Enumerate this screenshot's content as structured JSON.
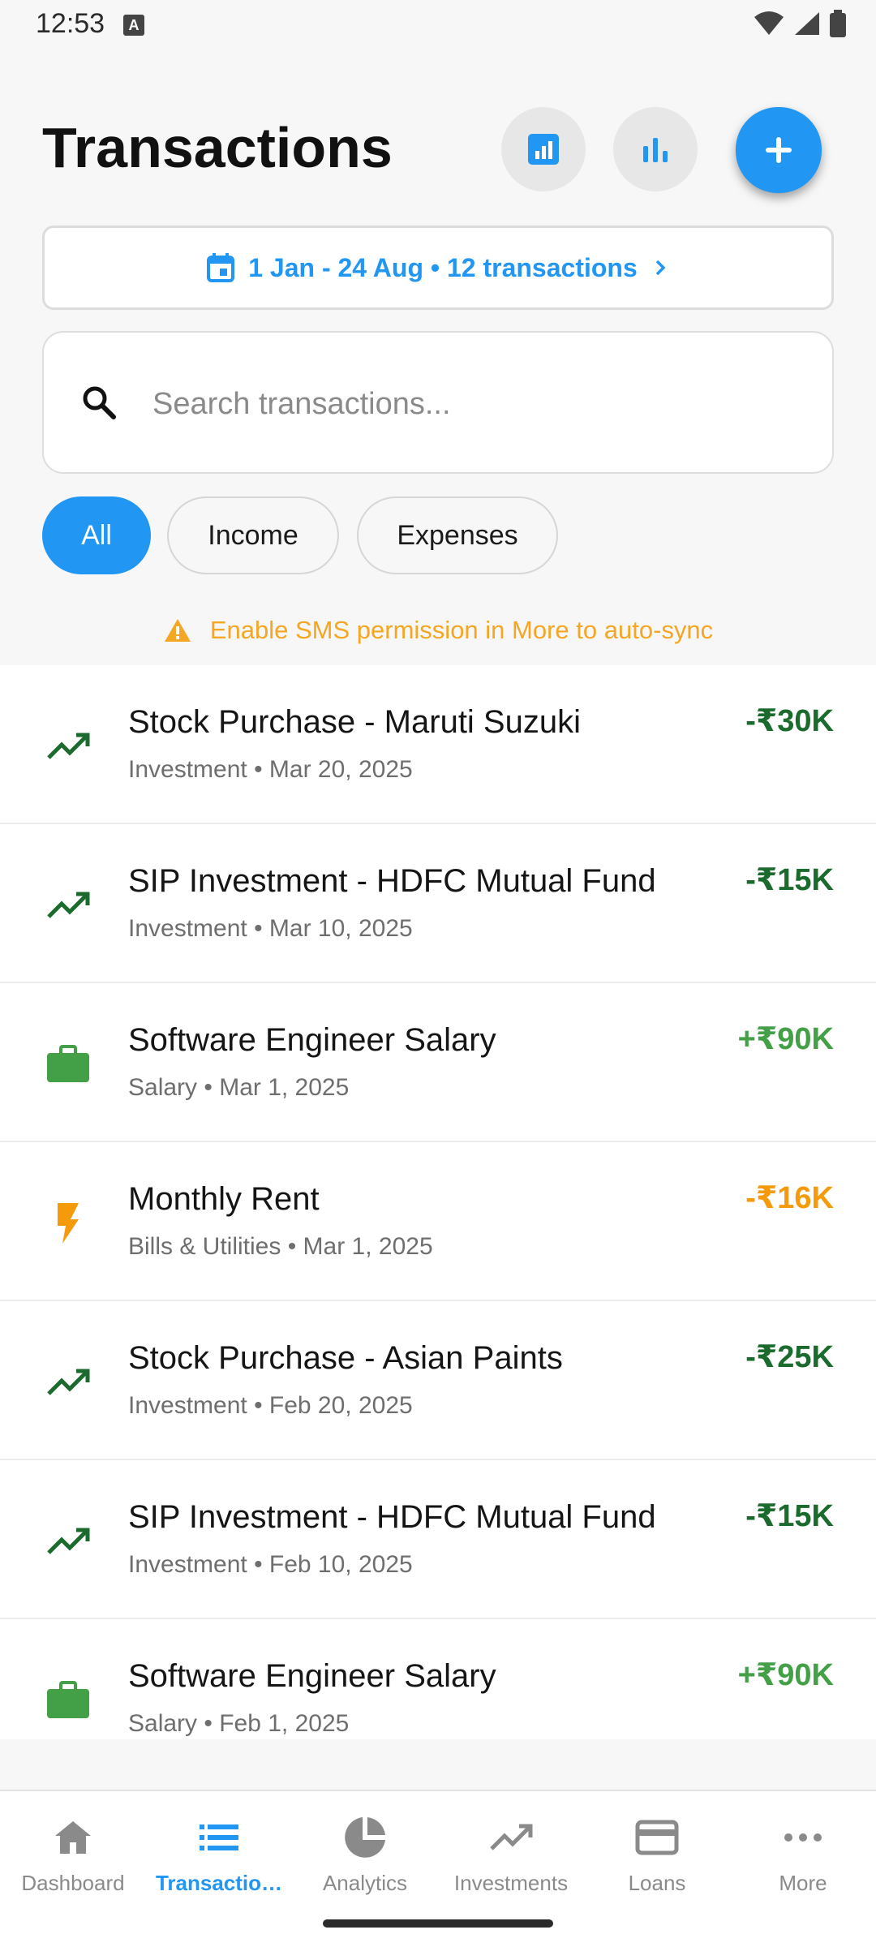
{
  "status_bar": {
    "time": "12:53",
    "notification_icon": "A"
  },
  "header": {
    "title": "Transactions",
    "buttons": [
      {
        "icon": "report-chart-icon",
        "label": ""
      },
      {
        "icon": "bar-chart-icon",
        "label": ""
      },
      {
        "icon": "add-icon",
        "label": ""
      }
    ]
  },
  "date_filter": {
    "label": "1 Jan - 24 Aug • 12 transactions"
  },
  "search": {
    "placeholder": "Search transactions...",
    "value": ""
  },
  "filters": {
    "all": "All",
    "income": "Income",
    "expenses": "Expenses",
    "selected": "All"
  },
  "sms_banner": {
    "text": "Enable SMS permission in More to auto-sync"
  },
  "colors": {
    "accent": "#2196f3",
    "investment_icon": "#1b6b2e",
    "investment_amount": "#1b6b2e",
    "salary": "#43a047",
    "bills": "#f59a0b",
    "warning": "#f5a623"
  },
  "transactions": [
    {
      "title": "Stock Purchase - Maruti Suzuki",
      "subtitle": "Investment • Mar 20, 2025",
      "amount": "-₹30K",
      "icon": "trending-up-icon",
      "type": "investment"
    },
    {
      "title": "SIP Investment - HDFC Mutual Fund",
      "subtitle": "Investment • Mar 10, 2025",
      "amount": "-₹15K",
      "icon": "trending-up-icon",
      "type": "investment"
    },
    {
      "title": "Software Engineer Salary",
      "subtitle": "Salary • Mar 1, 2025",
      "amount": "+₹90K",
      "icon": "briefcase-icon",
      "type": "salary"
    },
    {
      "title": "Monthly Rent",
      "subtitle": "Bills & Utilities • Mar 1, 2025",
      "amount": "-₹16K",
      "icon": "bolt-icon",
      "type": "bills"
    },
    {
      "title": "Stock Purchase - Asian Paints",
      "subtitle": "Investment • Feb 20, 2025",
      "amount": "-₹25K",
      "icon": "trending-up-icon",
      "type": "investment"
    },
    {
      "title": "SIP Investment - HDFC Mutual Fund",
      "subtitle": "Investment • Feb 10, 2025",
      "amount": "-₹15K",
      "icon": "trending-up-icon",
      "type": "investment"
    },
    {
      "title": "Software Engineer Salary",
      "subtitle": "Salary • Feb 1, 2025",
      "amount": "+₹90K",
      "icon": "briefcase-icon",
      "type": "salary"
    }
  ],
  "bottom_nav": {
    "items": [
      {
        "label": "Dashboard",
        "icon": "home-icon"
      },
      {
        "label": "Transactio…",
        "icon": "list-icon"
      },
      {
        "label": "Analytics",
        "icon": "pie-chart-icon"
      },
      {
        "label": "Investments",
        "icon": "trending-up-icon"
      },
      {
        "label": "Loans",
        "icon": "credit-card-icon"
      },
      {
        "label": "More",
        "icon": "more-horizontal-icon"
      }
    ],
    "active": "Transactio…"
  }
}
